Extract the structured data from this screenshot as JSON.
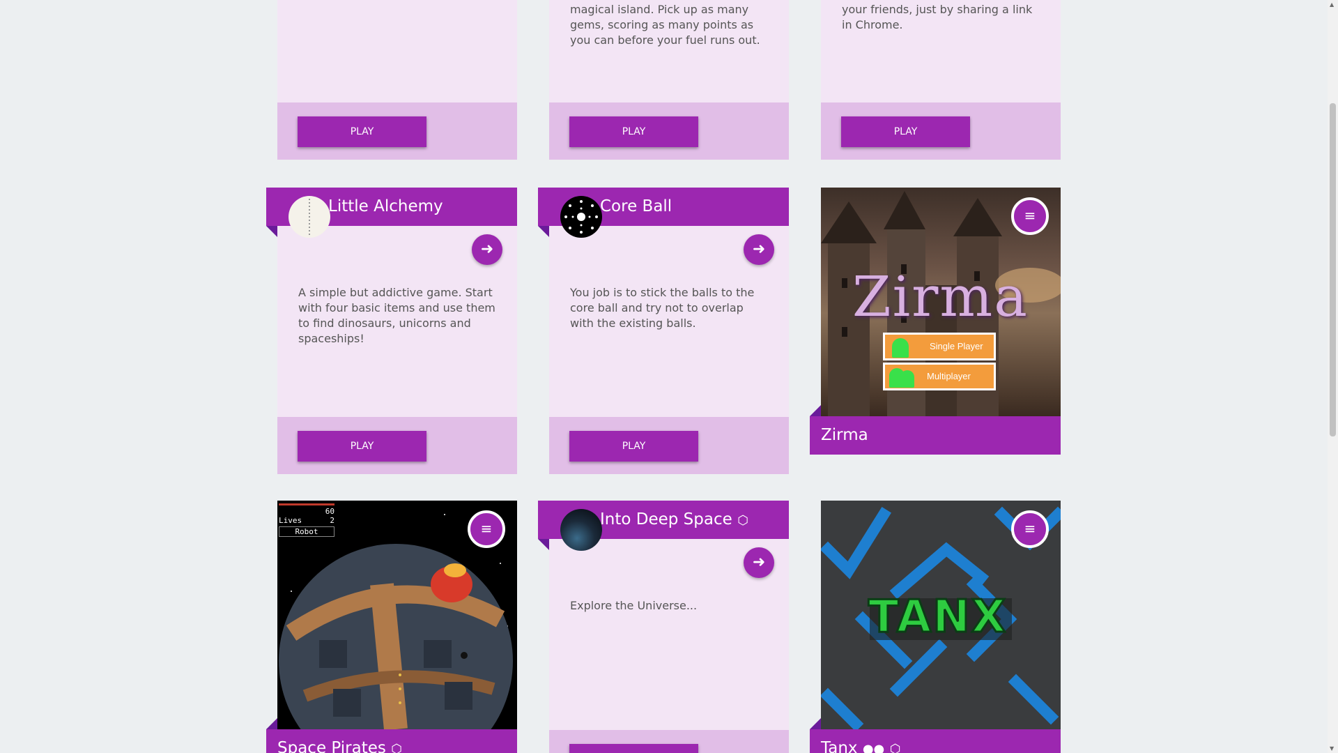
{
  "play_label": "PLAY",
  "icons": {
    "back": "arrow-left-icon",
    "menu": "menu-icon",
    "codepen": "codepen-icon"
  },
  "top_row": [
    {
      "desc": ""
    },
    {
      "desc": "magical island. Pick up as many gems, scoring as many points as you can before your fuel runs out."
    },
    {
      "desc": "your friends, just by sharing a link in Chrome."
    }
  ],
  "little_alchemy": {
    "title": "Little Alchemy",
    "desc": "A simple but addictive game. Start with four basic items and use them to find dinosaurs, unicorns and spaceships!"
  },
  "core_ball": {
    "title": "Core Ball",
    "desc": "You job is to stick the balls to the core ball and try not to overlap with the existing balls."
  },
  "zirma": {
    "title": "Zirma",
    "logo": "Zirma",
    "single": "Single Player",
    "multi": "Multiplayer"
  },
  "space_pirates": {
    "title": "Space Pirates",
    "hud_score": "60",
    "hud_lives_label": "Lives",
    "hud_lives": "2",
    "hud_robot": "Robot"
  },
  "into_deep_space": {
    "title": "Into Deep Space",
    "desc": "Explore the Universe..."
  },
  "tanx": {
    "title": "Tanx",
    "logo": "TANX"
  },
  "colors": {
    "accent": "#9c27b0",
    "card_bg": "#f3e5f5",
    "footer_bg": "#e1bee7"
  }
}
